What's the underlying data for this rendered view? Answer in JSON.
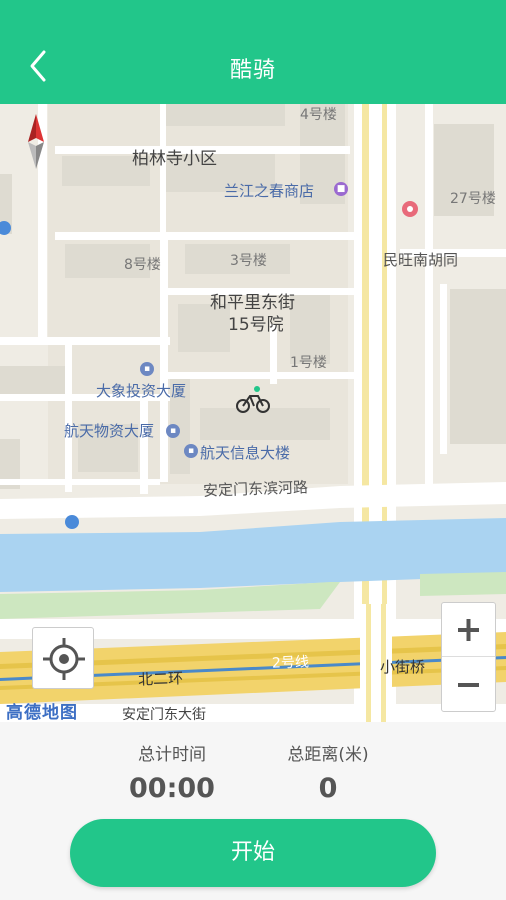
{
  "header": {
    "title": "酷骑"
  },
  "map": {
    "labels": {
      "b4": "4号楼",
      "bailin": "柏林寺小区",
      "lanjiang": "兰江之春商店",
      "b27": "27号楼",
      "minwang": "民旺南胡同",
      "b8": "8号楼",
      "b3": "3号楼",
      "heping1": "和平里东街",
      "heping2": "15号院",
      "b1": "1号楼",
      "daxiang": "大象投资大厦",
      "hangtianwuzi": "航天物资大厦",
      "hangtianxinxi": "航天信息大楼",
      "anding_river": "安定门东滨河路",
      "beierhuan": "北二环",
      "line2": "2号线",
      "xiaojieqiao": "小街桥",
      "anding_street": "安定门东大街"
    },
    "logo": "高德地图",
    "zoom_in": "+",
    "zoom_out": "−"
  },
  "stats": {
    "time_label": "总计时间",
    "time_value": "00:00",
    "distance_label": "总距离(米)",
    "distance_value": "0"
  },
  "start_button": "开始",
  "colors": {
    "accent": "#22c68a"
  }
}
